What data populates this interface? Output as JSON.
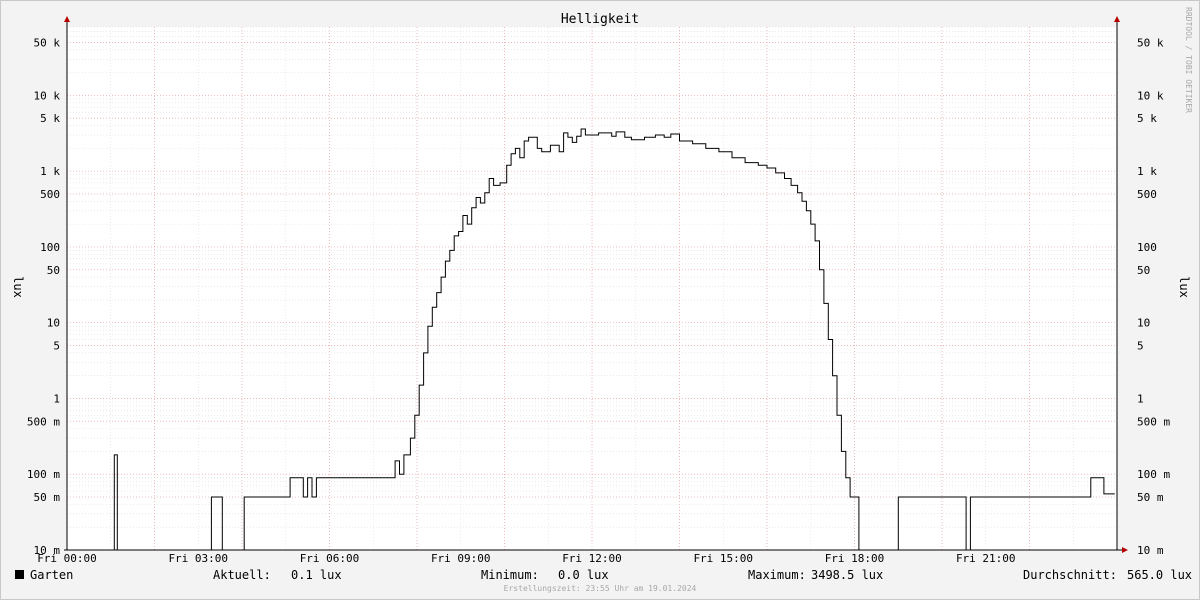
{
  "chart_data": {
    "type": "line",
    "title": "Helligkeit",
    "ylabel": "lux",
    "y_scale": "log",
    "ylim": [
      0.01,
      80000
    ],
    "xlim_hours": [
      0,
      24
    ],
    "grid": true,
    "y_ticks": [
      {
        "v": 0.01,
        "label": "10 m"
      },
      {
        "v": 0.05,
        "label": "50 m"
      },
      {
        "v": 0.1,
        "label": "100 m"
      },
      {
        "v": 0.5,
        "label": "500 m"
      },
      {
        "v": 1,
        "label": "1"
      },
      {
        "v": 5,
        "label": "5"
      },
      {
        "v": 10,
        "label": "10"
      },
      {
        "v": 50,
        "label": "50"
      },
      {
        "v": 100,
        "label": "100"
      },
      {
        "v": 500,
        "label": "500"
      },
      {
        "v": 1000,
        "label": "1 k"
      },
      {
        "v": 5000,
        "label": "5 k"
      },
      {
        "v": 10000,
        "label": "10 k"
      },
      {
        "v": 50000,
        "label": "50 k"
      }
    ],
    "x_ticks": [
      {
        "h": 0,
        "label": "Fri 00:00"
      },
      {
        "h": 3,
        "label": "Fri 03:00"
      },
      {
        "h": 6,
        "label": "Fri 06:00"
      },
      {
        "h": 9,
        "label": "Fri 09:00"
      },
      {
        "h": 12,
        "label": "Fri 12:00"
      },
      {
        "h": 15,
        "label": "Fri 15:00"
      },
      {
        "h": 18,
        "label": "Fri 18:00"
      },
      {
        "h": 21,
        "label": "Fri 21:00"
      }
    ],
    "series": [
      {
        "name": "Garten",
        "color": "#000000",
        "points": [
          [
            0.0,
            0.01
          ],
          [
            1.08,
            0.01
          ],
          [
            1.08,
            0.18
          ],
          [
            1.15,
            0.18
          ],
          [
            1.15,
            0.01
          ],
          [
            3.3,
            0.01
          ],
          [
            3.3,
            0.05
          ],
          [
            3.55,
            0.05
          ],
          [
            3.55,
            0.01
          ],
          [
            4.05,
            0.01
          ],
          [
            4.05,
            0.05
          ],
          [
            5.1,
            0.05
          ],
          [
            5.1,
            0.09
          ],
          [
            5.4,
            0.09
          ],
          [
            5.4,
            0.05
          ],
          [
            5.5,
            0.05
          ],
          [
            5.5,
            0.09
          ],
          [
            5.6,
            0.09
          ],
          [
            5.6,
            0.05
          ],
          [
            5.7,
            0.05
          ],
          [
            5.7,
            0.09
          ],
          [
            7.5,
            0.09
          ],
          [
            7.5,
            0.15
          ],
          [
            7.6,
            0.15
          ],
          [
            7.6,
            0.1
          ],
          [
            7.7,
            0.1
          ],
          [
            7.7,
            0.18
          ],
          [
            7.85,
            0.18
          ],
          [
            7.85,
            0.3
          ],
          [
            7.95,
            0.3
          ],
          [
            7.95,
            0.6
          ],
          [
            8.05,
            0.6
          ],
          [
            8.05,
            1.5
          ],
          [
            8.15,
            1.5
          ],
          [
            8.15,
            4
          ],
          [
            8.25,
            4
          ],
          [
            8.25,
            9
          ],
          [
            8.35,
            9
          ],
          [
            8.35,
            16
          ],
          [
            8.45,
            16
          ],
          [
            8.45,
            25
          ],
          [
            8.55,
            25
          ],
          [
            8.55,
            40
          ],
          [
            8.65,
            40
          ],
          [
            8.65,
            65
          ],
          [
            8.75,
            65
          ],
          [
            8.75,
            90
          ],
          [
            8.85,
            90
          ],
          [
            8.85,
            140
          ],
          [
            8.95,
            140
          ],
          [
            8.95,
            160
          ],
          [
            9.05,
            160
          ],
          [
            9.05,
            260
          ],
          [
            9.15,
            260
          ],
          [
            9.15,
            200
          ],
          [
            9.25,
            200
          ],
          [
            9.25,
            330
          ],
          [
            9.35,
            330
          ],
          [
            9.35,
            450
          ],
          [
            9.45,
            450
          ],
          [
            9.45,
            380
          ],
          [
            9.55,
            380
          ],
          [
            9.55,
            520
          ],
          [
            9.65,
            520
          ],
          [
            9.65,
            800
          ],
          [
            9.75,
            800
          ],
          [
            9.75,
            650
          ],
          [
            9.9,
            650
          ],
          [
            9.9,
            700
          ],
          [
            10.05,
            700
          ],
          [
            10.05,
            1200
          ],
          [
            10.15,
            1200
          ],
          [
            10.15,
            1700
          ],
          [
            10.25,
            1700
          ],
          [
            10.25,
            2000
          ],
          [
            10.35,
            2000
          ],
          [
            10.35,
            1500
          ],
          [
            10.45,
            1500
          ],
          [
            10.45,
            2500
          ],
          [
            10.55,
            2500
          ],
          [
            10.55,
            2800
          ],
          [
            10.75,
            2800
          ],
          [
            10.75,
            2000
          ],
          [
            10.85,
            2000
          ],
          [
            10.85,
            1800
          ],
          [
            11.05,
            1800
          ],
          [
            11.05,
            2200
          ],
          [
            11.25,
            2200
          ],
          [
            11.25,
            1800
          ],
          [
            11.35,
            1800
          ],
          [
            11.35,
            3200
          ],
          [
            11.45,
            3200
          ],
          [
            11.45,
            2800
          ],
          [
            11.55,
            2800
          ],
          [
            11.55,
            2400
          ],
          [
            11.65,
            2400
          ],
          [
            11.65,
            2900
          ],
          [
            11.75,
            2900
          ],
          [
            11.75,
            3600
          ],
          [
            11.85,
            3600
          ],
          [
            11.85,
            3000
          ],
          [
            12.15,
            3000
          ],
          [
            12.15,
            3200
          ],
          [
            12.45,
            3200
          ],
          [
            12.45,
            2900
          ],
          [
            12.55,
            2900
          ],
          [
            12.55,
            3300
          ],
          [
            12.75,
            3300
          ],
          [
            12.75,
            2800
          ],
          [
            12.9,
            2800
          ],
          [
            12.9,
            2600
          ],
          [
            13.2,
            2600
          ],
          [
            13.2,
            2800
          ],
          [
            13.45,
            2800
          ],
          [
            13.45,
            3000
          ],
          [
            13.65,
            3000
          ],
          [
            13.65,
            2800
          ],
          [
            13.8,
            2800
          ],
          [
            13.8,
            3100
          ],
          [
            14.0,
            3100
          ],
          [
            14.0,
            2500
          ],
          [
            14.3,
            2500
          ],
          [
            14.3,
            2300
          ],
          [
            14.6,
            2300
          ],
          [
            14.6,
            2000
          ],
          [
            14.9,
            2000
          ],
          [
            14.9,
            1800
          ],
          [
            15.2,
            1800
          ],
          [
            15.2,
            1500
          ],
          [
            15.5,
            1500
          ],
          [
            15.5,
            1300
          ],
          [
            15.8,
            1300
          ],
          [
            15.8,
            1200
          ],
          [
            16.0,
            1200
          ],
          [
            16.0,
            1100
          ],
          [
            16.2,
            1100
          ],
          [
            16.2,
            950
          ],
          [
            16.4,
            950
          ],
          [
            16.4,
            800
          ],
          [
            16.55,
            800
          ],
          [
            16.55,
            650
          ],
          [
            16.7,
            650
          ],
          [
            16.7,
            520
          ],
          [
            16.8,
            520
          ],
          [
            16.8,
            400
          ],
          [
            16.9,
            400
          ],
          [
            16.9,
            300
          ],
          [
            17.0,
            300
          ],
          [
            17.0,
            200
          ],
          [
            17.1,
            200
          ],
          [
            17.1,
            120
          ],
          [
            17.2,
            120
          ],
          [
            17.2,
            50
          ],
          [
            17.3,
            50
          ],
          [
            17.3,
            18
          ],
          [
            17.4,
            18
          ],
          [
            17.4,
            6
          ],
          [
            17.5,
            6
          ],
          [
            17.5,
            2
          ],
          [
            17.6,
            2
          ],
          [
            17.6,
            0.6
          ],
          [
            17.7,
            0.6
          ],
          [
            17.7,
            0.2
          ],
          [
            17.8,
            0.2
          ],
          [
            17.8,
            0.09
          ],
          [
            17.9,
            0.09
          ],
          [
            17.9,
            0.05
          ],
          [
            18.1,
            0.05
          ],
          [
            18.1,
            0.01
          ],
          [
            19.0,
            0.01
          ],
          [
            19.0,
            0.05
          ],
          [
            20.55,
            0.05
          ],
          [
            20.55,
            0.01
          ],
          [
            20.65,
            0.01
          ],
          [
            20.65,
            0.05
          ],
          [
            23.4,
            0.05
          ],
          [
            23.4,
            0.09
          ],
          [
            23.7,
            0.09
          ],
          [
            23.7,
            0.055
          ],
          [
            23.95,
            0.055
          ]
        ]
      }
    ]
  },
  "side_credit": "RRDTOOL / TOBI OETIKER",
  "legend": {
    "name": "Garten",
    "swatch_color": "#000000",
    "current_label": "Aktuell:",
    "current_value": "0.1 lux",
    "min_label": "Minimum:",
    "min_value": "0.0 lux",
    "max_label": "Maximum:",
    "max_value": "3498.5 lux",
    "avg_label": "Durchschnitt:",
    "avg_value": "565.0 lux"
  },
  "footer": "Erstellungszeit: 23:55 Uhr am 19.01.2024"
}
